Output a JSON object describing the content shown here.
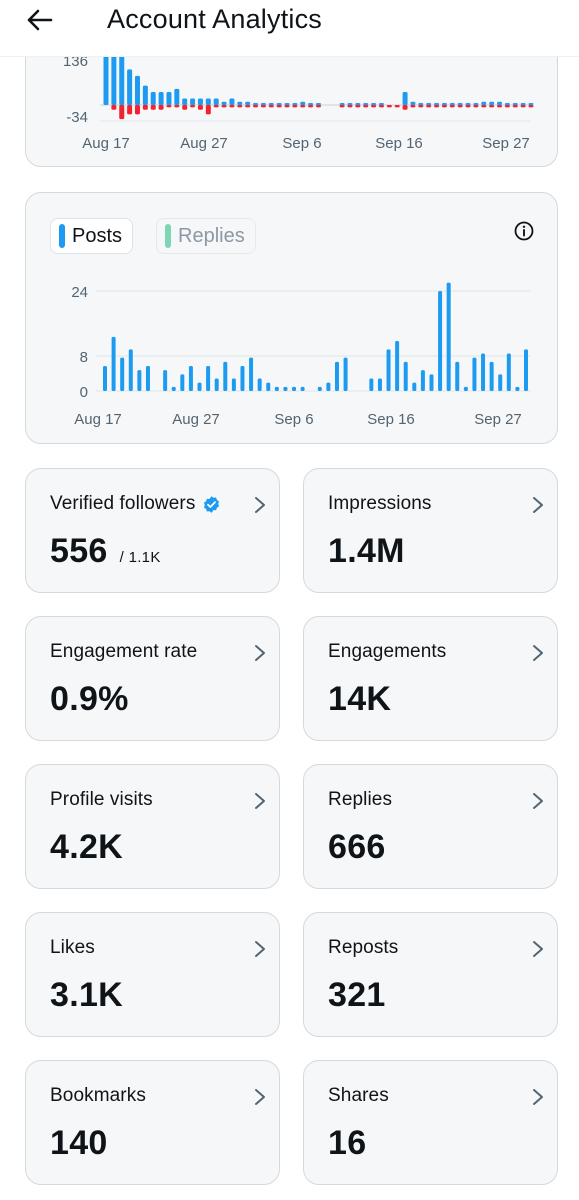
{
  "header": {
    "title": "Account Analytics",
    "back_icon": "arrow-left-icon"
  },
  "colors": {
    "accent": "#1d9bf0",
    "negative": "#f4212e",
    "replies": "#7fd6b7",
    "text": "#0f1419",
    "muted": "#536471"
  },
  "follower_chart": {
    "ytick_labels": [
      "136",
      "-34"
    ],
    "xtick_labels": [
      "Aug 17",
      "Aug 27",
      "Sep 6",
      "Sep 16",
      "Sep 27"
    ]
  },
  "posts_chart": {
    "legend": {
      "posts": "Posts",
      "replies": "Replies"
    },
    "info_icon": "info-circle-icon",
    "ytick_labels": [
      "24",
      "8",
      "0"
    ],
    "xtick_labels": [
      "Aug 17",
      "Aug 27",
      "Sep 6",
      "Sep 16",
      "Sep 27"
    ]
  },
  "chart_data": [
    {
      "type": "bar",
      "series": [
        {
          "name": "",
          "values": [
            190,
            170,
            160,
            110,
            90,
            60,
            40,
            40,
            40,
            50,
            20,
            20,
            20,
            20,
            20,
            10,
            20,
            10,
            10,
            5,
            5,
            5,
            5,
            5,
            5,
            10,
            5,
            5,
            0,
            0,
            5,
            5,
            5,
            5,
            5,
            5,
            0,
            0,
            40,
            10,
            5,
            5,
            5,
            5,
            5,
            5,
            5,
            5,
            10,
            10,
            10,
            5,
            5,
            5,
            5
          ]
        },
        {
          "name": "",
          "values": [
            0,
            -10,
            -30,
            -20,
            -20,
            -10,
            -10,
            -10,
            -5,
            -5,
            -10,
            -5,
            -10,
            -20,
            -5,
            -5,
            -5,
            -5,
            -5,
            -5,
            -5,
            -5,
            -5,
            -5,
            -5,
            -5,
            -5,
            -5,
            0,
            0,
            -5,
            -5,
            -5,
            -5,
            -5,
            -5,
            -5,
            -5,
            -10,
            -5,
            -5,
            -5,
            -5,
            -5,
            -5,
            -5,
            -5,
            -5,
            -5,
            -5,
            -5,
            -5,
            -5,
            -5,
            -5
          ]
        }
      ],
      "ylim": [
        -34,
        136
      ],
      "xlabel": "",
      "ylabel": ""
    },
    {
      "type": "bar",
      "series": [
        {
          "name": "Posts",
          "values": [
            6,
            13,
            8,
            10,
            5,
            6,
            0,
            5,
            1,
            4,
            6,
            2,
            6,
            3,
            7,
            3,
            6,
            8,
            3,
            2,
            1,
            1,
            1,
            1,
            0,
            1,
            2,
            7,
            8,
            0,
            0,
            3,
            3,
            10,
            12,
            7,
            2,
            5,
            4,
            24,
            26,
            7,
            1,
            8,
            9,
            7,
            4,
            9,
            1,
            10
          ]
        },
        {
          "name": "Replies",
          "values": []
        }
      ],
      "ylim": [
        0,
        26
      ],
      "xlabel": "",
      "ylabel": ""
    }
  ],
  "stats": [
    {
      "label": "Verified followers",
      "value": "556",
      "sub": "/ 1.1K",
      "verified": true
    },
    {
      "label": "Impressions",
      "value": "1.4M"
    },
    {
      "label": "Engagement rate",
      "value": "0.9%"
    },
    {
      "label": "Engagements",
      "value": "14K"
    },
    {
      "label": "Profile visits",
      "value": "4.2K"
    },
    {
      "label": "Replies",
      "value": "666"
    },
    {
      "label": "Likes",
      "value": "3.1K"
    },
    {
      "label": "Reposts",
      "value": "321"
    },
    {
      "label": "Bookmarks",
      "value": "140"
    },
    {
      "label": "Shares",
      "value": "16"
    }
  ]
}
